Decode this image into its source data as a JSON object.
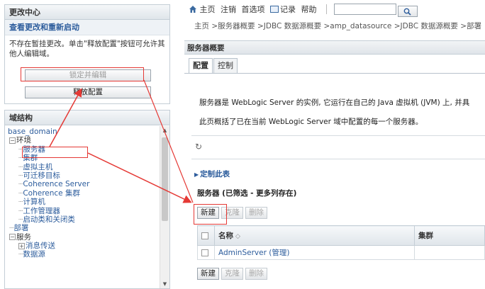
{
  "change_center": {
    "title": "更改中心",
    "link": "查看更改和重新启动",
    "message": "不存在暂挂更改。单击\"释放配置\"按钮可允许其他人编辑域。",
    "lock_button": "锁定并编辑",
    "release_button": "释放配置"
  },
  "domain_structure": {
    "title": "域结构",
    "items": [
      {
        "label": "base_domain",
        "prefix": ""
      },
      {
        "label": "环境",
        "prefix": "⊟"
      },
      {
        "label": "服务器",
        "prefix": "·····"
      },
      {
        "label": "集群",
        "prefix": "·····"
      },
      {
        "label": "虚拟主机",
        "prefix": "·····"
      },
      {
        "label": "可迁移目标",
        "prefix": "·····"
      },
      {
        "label": "Coherence Server",
        "prefix": "·····"
      },
      {
        "label": "Coherence 集群",
        "prefix": "·····"
      },
      {
        "label": "计算机",
        "prefix": "·····"
      },
      {
        "label": "工作管理器",
        "prefix": "·····"
      },
      {
        "label": "启动类和关闭类",
        "prefix": "·····"
      },
      {
        "label": "部署",
        "prefix": "···"
      },
      {
        "label": "服务",
        "prefix": "⊟"
      },
      {
        "label": "消息传送",
        "prefix": "⊞"
      },
      {
        "label": "数据源",
        "prefix": "·····"
      }
    ]
  },
  "topnav": {
    "home": "主页",
    "logout": "注销",
    "prefs": "首选项",
    "record": "记录",
    "help": "帮助",
    "search_value": ""
  },
  "breadcrumb": "主页 >服务器概要 >JDBC 数据源概要 >amp_datasource >JDBC 数据源概要 >部署",
  "section_title": "服务器概要",
  "tabs": [
    "配置",
    "控制"
  ],
  "description": {
    "line1": "服务器是 WebLogic Server 的实例, 它运行在自己的 Java 虚拟机 (JVM) 上, 并具",
    "line2": "此页概括了已在当前 WebLogic Server 域中配置的每一个服务器。"
  },
  "customize_link": "定制此表",
  "table": {
    "title": "服务器 (已筛选 - 更多列存在)",
    "buttons": {
      "new": "新建",
      "clone": "克隆",
      "delete": "删除"
    },
    "columns": [
      "名称",
      "集群"
    ],
    "rows": [
      {
        "name": "AdminServer (管理)",
        "cluster": ""
      }
    ]
  },
  "colors": {
    "link": "#2c5c9c",
    "annotation": "#e53935",
    "panel_border": "#c4ced6"
  }
}
